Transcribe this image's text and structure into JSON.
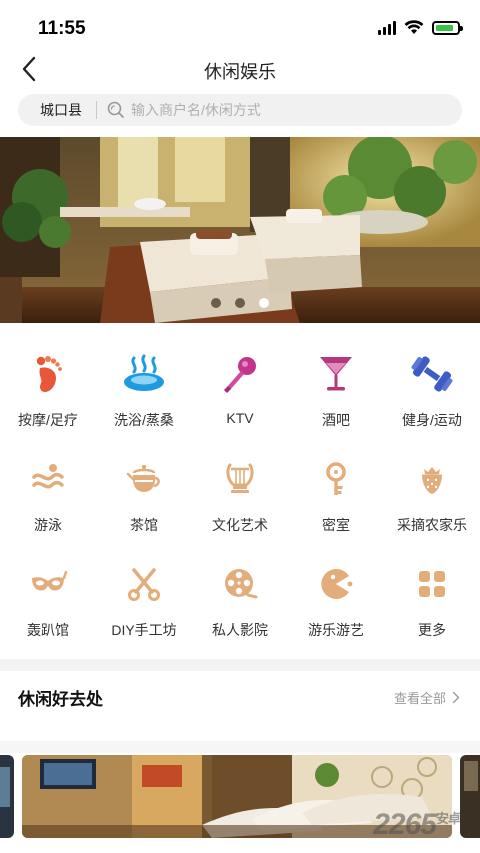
{
  "status": {
    "time": "11:55",
    "battery_level": 0.85
  },
  "nav": {
    "title": "休闲娱乐"
  },
  "search": {
    "city": "城口县",
    "placeholder": "输入商户名/休闲方式"
  },
  "banner": {
    "page_count": 3,
    "active_index": 2
  },
  "categories": [
    {
      "label": "按摩/足疗",
      "icon": "footprint-icon",
      "color": "#e8573a"
    },
    {
      "label": "洗浴/蒸桑",
      "icon": "hot-spring-icon",
      "color": "#1e9be0"
    },
    {
      "label": "KTV",
      "icon": "microphone-icon",
      "color": "#c2348e"
    },
    {
      "label": "酒吧",
      "icon": "cocktail-icon",
      "color": "#b5387f"
    },
    {
      "label": "健身/运动",
      "icon": "dumbbell-icon",
      "color": "#3d5dc4"
    },
    {
      "label": "游泳",
      "icon": "waves-icon",
      "color": "#e2ad7b"
    },
    {
      "label": "茶馆",
      "icon": "teapot-icon",
      "color": "#e2ad7b"
    },
    {
      "label": "文化艺术",
      "icon": "lyre-icon",
      "color": "#e2ad7b"
    },
    {
      "label": "密室",
      "icon": "key-icon",
      "color": "#e2ad7b"
    },
    {
      "label": "采摘农家乐",
      "icon": "strawberry-icon",
      "color": "#e2ad7b"
    },
    {
      "label": "轰趴馆",
      "icon": "mask-icon",
      "color": "#e2ad7b"
    },
    {
      "label": "DIY手工坊",
      "icon": "scissors-icon",
      "color": "#e2ad7b"
    },
    {
      "label": "私人影院",
      "icon": "film-reel-icon",
      "color": "#e2ad7b"
    },
    {
      "label": "游乐游艺",
      "icon": "pacman-icon",
      "color": "#e2ad7b"
    },
    {
      "label": "更多",
      "icon": "grid-more-icon",
      "color": "#e2ad7b"
    }
  ],
  "section": {
    "title": "休闲好去处",
    "view_all": "查看全部"
  },
  "watermark": {
    "text": "2265",
    "suffix": "安卓"
  }
}
